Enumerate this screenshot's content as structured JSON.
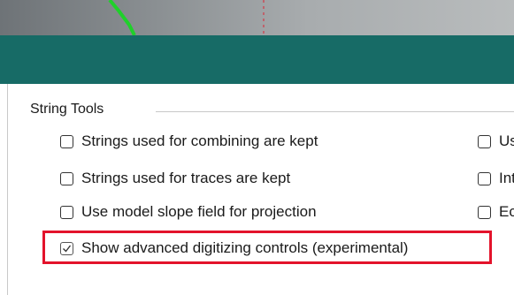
{
  "group": {
    "title": "String Tools"
  },
  "options_left": [
    {
      "label": "Strings used for combining are kept",
      "checked": false
    },
    {
      "label": "Strings used for traces are kept",
      "checked": false
    },
    {
      "label": "Use model slope field for projection",
      "checked": false
    },
    {
      "label": "Show advanced digitizing controls (experimental)",
      "checked": true
    }
  ],
  "options_right": [
    {
      "label": "Us",
      "checked": false
    },
    {
      "label": "Int",
      "checked": false
    },
    {
      "label": "Ec",
      "checked": false
    }
  ],
  "colors": {
    "header_bar": "#176b66",
    "highlight_box": "#e3132b",
    "map_line": "#1fd12a"
  }
}
